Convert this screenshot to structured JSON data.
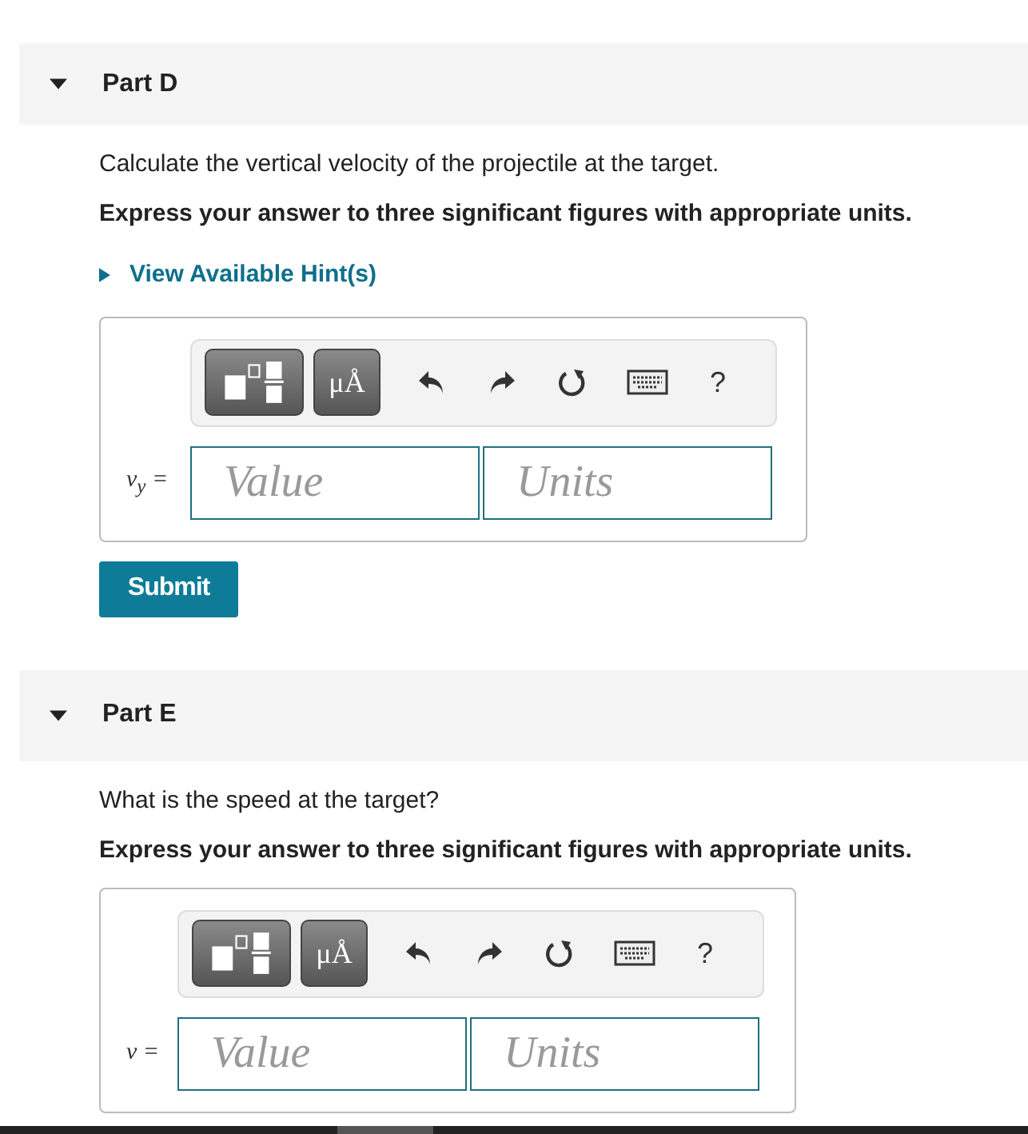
{
  "parts": [
    {
      "title": "Part D",
      "expanded": true,
      "question": "Calculate the vertical velocity of the projectile at the target.",
      "instruction": "Express your answer to three significant figures with appropriate units.",
      "hint": {
        "label": "View Available Hint(s)",
        "expanded": false
      },
      "answer": {
        "units_symbol": "μÅ",
        "help": "?",
        "label": "*v*$_{y}$ =",
        "value_placeholder": "Value",
        "units_placeholder": "Units"
      },
      "submit": "Submit"
    },
    {
      "title": "Part E",
      "expanded": true,
      "question": "What is the speed at the target?",
      "instruction": "Express your answer to three significant figures with appropriate units.",
      "answer": {
        "units_symbol": "μÅ",
        "help": "?",
        "label": "*v* =",
        "value_placeholder": "Value",
        "units_placeholder": "Units"
      }
    }
  ]
}
